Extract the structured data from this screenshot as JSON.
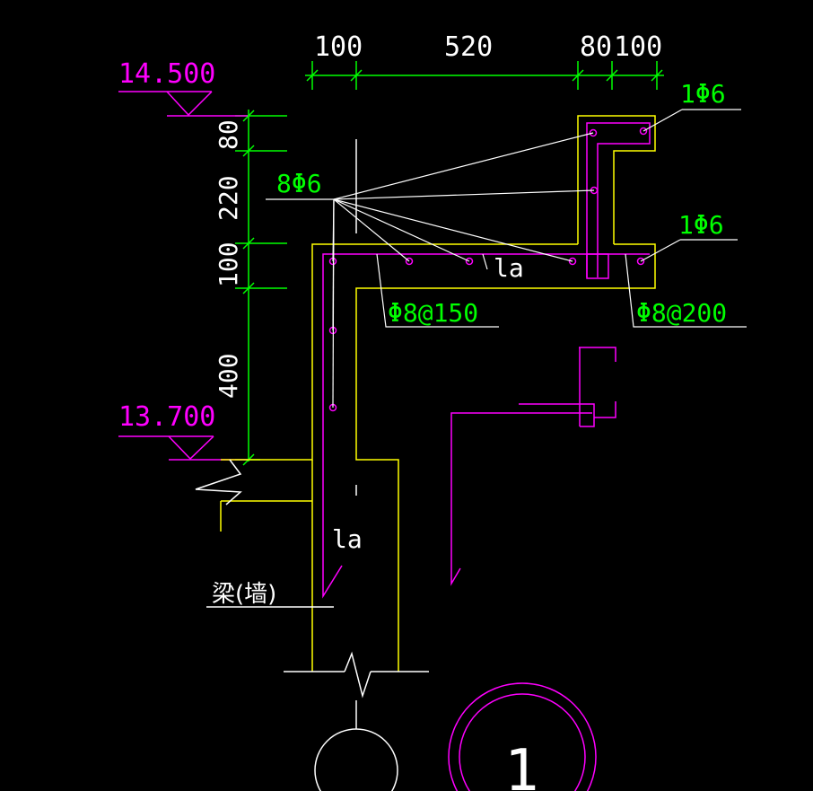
{
  "drawing": {
    "top_dimensions": [
      "100",
      "520",
      "80",
      "100"
    ],
    "left_dimensions": [
      "80",
      "220",
      "100",
      "400"
    ],
    "elevations": {
      "top": "14.500",
      "bottom": "13.700"
    },
    "rebar_labels": {
      "top_right": "1Φ6",
      "middle_right": "1Φ6",
      "fan_group": "8Φ6",
      "slab_left": "Φ8@150",
      "slab_right": "Φ8@200"
    },
    "anchorage_labels": {
      "slab": "la",
      "wall": "la"
    },
    "support_label": "梁(墙)",
    "detail_number": "1"
  },
  "colors": {
    "background": "#000000",
    "concrete": "#ffff00",
    "rebar": "#ff00ff",
    "dimension": "#00ff00",
    "text": "#ffffff"
  }
}
